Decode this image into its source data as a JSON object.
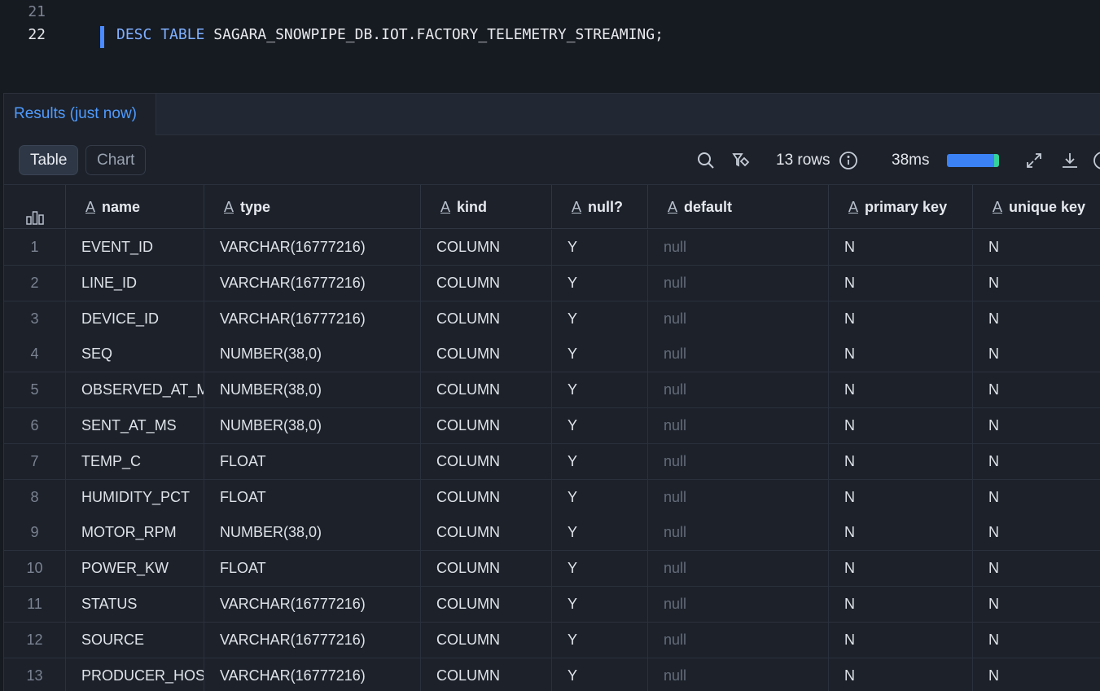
{
  "editor": {
    "lines": [
      {
        "number": "21",
        "text": ""
      },
      {
        "number": "22",
        "keyword1": "DESC",
        "keyword2": "TABLE",
        "target": "SAGARA_SNOWPIPE_DB.IOT.FACTORY_TELEMETRY_STREAMING;"
      }
    ]
  },
  "results": {
    "tab_label": "Results (just now)",
    "view_toggle": {
      "table": "Table",
      "chart": "Chart",
      "selected": "Table"
    },
    "row_count": "13 rows",
    "duration": "38ms",
    "duration_bar_fraction": 0.9,
    "icons": [
      "search-icon",
      "filter-icon",
      "info-icon",
      "expand-icon",
      "download-icon"
    ]
  },
  "table": {
    "columns": [
      "name",
      "type",
      "kind",
      "null?",
      "default",
      "primary key",
      "unique key"
    ],
    "rows": [
      {
        "i": "1",
        "name": "EVENT_ID",
        "type": "VARCHAR(16777216)",
        "kind": "COLUMN",
        "null": "Y",
        "default": "null",
        "pk": "N",
        "uk": "N"
      },
      {
        "i": "2",
        "name": "LINE_ID",
        "type": "VARCHAR(16777216)",
        "kind": "COLUMN",
        "null": "Y",
        "default": "null",
        "pk": "N",
        "uk": "N"
      },
      {
        "i": "3",
        "name": "DEVICE_ID",
        "type": "VARCHAR(16777216)",
        "kind": "COLUMN",
        "null": "Y",
        "default": "null",
        "pk": "N",
        "uk": "N"
      },
      {
        "i": "4",
        "name": "SEQ",
        "type": "NUMBER(38,0)",
        "kind": "COLUMN",
        "null": "Y",
        "default": "null",
        "pk": "N",
        "uk": "N"
      },
      {
        "i": "5",
        "name": "OBSERVED_AT_M",
        "type": "NUMBER(38,0)",
        "kind": "COLUMN",
        "null": "Y",
        "default": "null",
        "pk": "N",
        "uk": "N"
      },
      {
        "i": "6",
        "name": "SENT_AT_MS",
        "type": "NUMBER(38,0)",
        "kind": "COLUMN",
        "null": "Y",
        "default": "null",
        "pk": "N",
        "uk": "N"
      },
      {
        "i": "7",
        "name": "TEMP_C",
        "type": "FLOAT",
        "kind": "COLUMN",
        "null": "Y",
        "default": "null",
        "pk": "N",
        "uk": "N"
      },
      {
        "i": "8",
        "name": "HUMIDITY_PCT",
        "type": "FLOAT",
        "kind": "COLUMN",
        "null": "Y",
        "default": "null",
        "pk": "N",
        "uk": "N"
      },
      {
        "i": "9",
        "name": "MOTOR_RPM",
        "type": "NUMBER(38,0)",
        "kind": "COLUMN",
        "null": "Y",
        "default": "null",
        "pk": "N",
        "uk": "N"
      },
      {
        "i": "10",
        "name": "POWER_KW",
        "type": "FLOAT",
        "kind": "COLUMN",
        "null": "Y",
        "default": "null",
        "pk": "N",
        "uk": "N"
      },
      {
        "i": "11",
        "name": "STATUS",
        "type": "VARCHAR(16777216)",
        "kind": "COLUMN",
        "null": "Y",
        "default": "null",
        "pk": "N",
        "uk": "N"
      },
      {
        "i": "12",
        "name": "SOURCE",
        "type": "VARCHAR(16777216)",
        "kind": "COLUMN",
        "null": "Y",
        "default": "null",
        "pk": "N",
        "uk": "N"
      },
      {
        "i": "13",
        "name": "PRODUCER_HOS",
        "type": "VARCHAR(16777216)",
        "kind": "COLUMN",
        "null": "Y",
        "default": "null",
        "pk": "N",
        "uk": "N"
      }
    ]
  },
  "colors": {
    "accent": "#4f9bff",
    "background": "#161a21",
    "panel": "#1c212a"
  }
}
